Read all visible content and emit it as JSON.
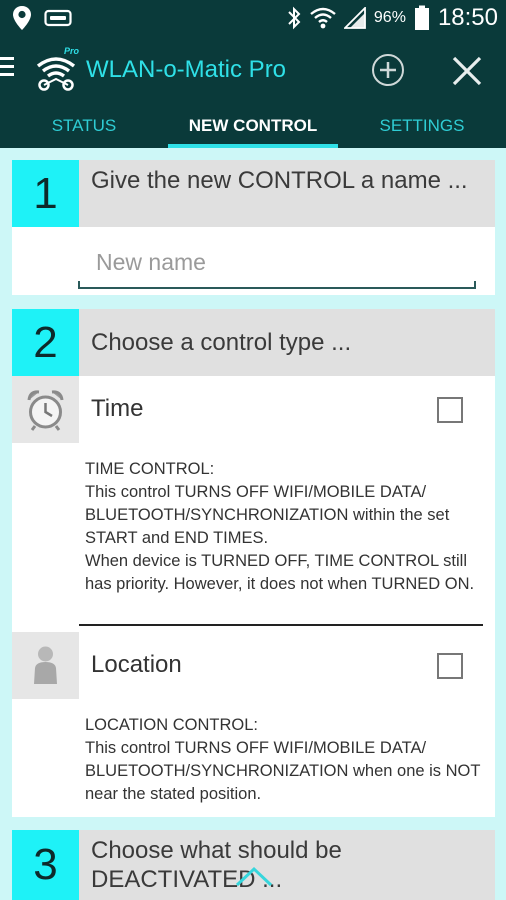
{
  "status_bar": {
    "battery_percent": "96%",
    "time": "18:50"
  },
  "app_bar": {
    "title": "WLAN-o-Matic Pro",
    "logo_badge": "Pro"
  },
  "tabs": [
    {
      "label": "STATUS",
      "active": false
    },
    {
      "label": "NEW CONTROL",
      "active": true
    },
    {
      "label": "SETTINGS",
      "active": false
    }
  ],
  "step1": {
    "number": "1",
    "title": "Give the new CONTROL a name ...",
    "name_placeholder": "New name",
    "name_value": ""
  },
  "step2": {
    "number": "2",
    "title": "Choose a control type ...",
    "options": [
      {
        "label": "Time",
        "icon": "alarm-clock-icon",
        "checked": false,
        "description": "TIME CONTROL:\nThis control TURNS OFF WIFI/MOBILE DATA/ BLUETOOTH/SYNCHRONIZATION within the set START and END TIMES.\nWhen device is TURNED OFF, TIME CONTROL still has priority. However, it does not when TURNED ON."
      },
      {
        "label": "Location",
        "icon": "person-icon",
        "checked": false,
        "description": "LOCATION CONTROL:\nThis control TURNS OFF WIFI/MOBILE DATA/ BLUETOOTH/SYNCHRONIZATION when one is NOT near the stated position."
      }
    ]
  },
  "step3": {
    "number": "3",
    "title": "Choose what should be DEACTIVATED ..."
  },
  "colors": {
    "toolbar_bg": "#0a3a3a",
    "accent_cyan": "#1ef2f7",
    "title_cyan": "#2fe0e7",
    "page_bg": "#cdf7f7"
  }
}
